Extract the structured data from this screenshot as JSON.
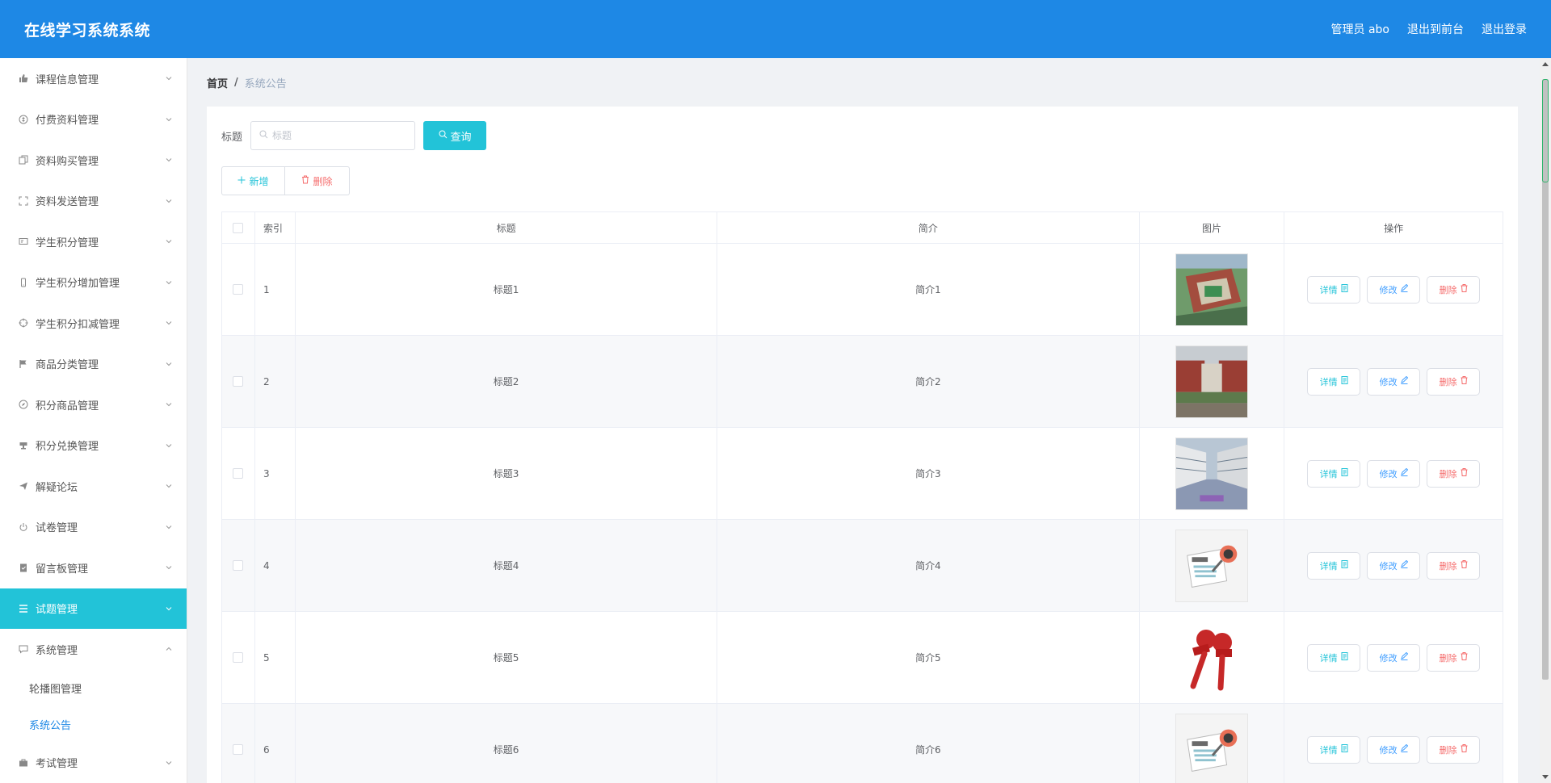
{
  "header": {
    "title": "在线学习系统系统",
    "user": "管理员 abo",
    "to_front": "退出到前台",
    "logout": "退出登录"
  },
  "sidebar": {
    "items": [
      {
        "label": "课程信息管理",
        "icon": "thumb-icon"
      },
      {
        "label": "付费资料管理",
        "icon": "coin-icon"
      },
      {
        "label": "资料购买管理",
        "icon": "copy-icon"
      },
      {
        "label": "资料发送管理",
        "icon": "fullscreen-icon"
      },
      {
        "label": "学生积分管理",
        "icon": "card-icon"
      },
      {
        "label": "学生积分增加管理",
        "icon": "mobile-icon"
      },
      {
        "label": "学生积分扣减管理",
        "icon": "aim-icon"
      },
      {
        "label": "商品分类管理",
        "icon": "flag-icon"
      },
      {
        "label": "积分商品管理",
        "icon": "compass-icon"
      },
      {
        "label": "积分兑换管理",
        "icon": "stamp-icon"
      },
      {
        "label": "解疑论坛",
        "icon": "send-icon"
      },
      {
        "label": "试卷管理",
        "icon": "power-icon"
      },
      {
        "label": "留言板管理",
        "icon": "clipboard-icon"
      },
      {
        "label": "试题管理",
        "icon": "grid-icon"
      },
      {
        "label": "系统管理",
        "icon": "chat-icon"
      },
      {
        "label": "考试管理",
        "icon": "briefcase-icon"
      }
    ],
    "system_sub": [
      "轮播图管理",
      "系统公告"
    ]
  },
  "breadcrumb": {
    "home": "首页",
    "sep": "/",
    "current": "系统公告"
  },
  "search": {
    "label": "标题",
    "placeholder": "标题",
    "button": "查询"
  },
  "actions": {
    "add": "新增",
    "delete": "删除"
  },
  "table": {
    "headers": {
      "index": "索引",
      "title": "标题",
      "intro": "简介",
      "image": "图片",
      "op": "操作"
    },
    "ops": {
      "detail": "详情",
      "edit": "修改",
      "remove": "删除"
    },
    "rows": [
      {
        "index": "1",
        "title": "标题1",
        "intro": "简介1",
        "image": "campus-aerial"
      },
      {
        "index": "2",
        "title": "标题2",
        "intro": "简介2",
        "image": "campus-building"
      },
      {
        "index": "3",
        "title": "标题3",
        "intro": "简介3",
        "image": "campus-courtyard"
      },
      {
        "index": "4",
        "title": "标题4",
        "intro": "简介4",
        "image": "news-illustration"
      },
      {
        "index": "5",
        "title": "标题5",
        "intro": "简介5",
        "image": "live-microphone"
      },
      {
        "index": "6",
        "title": "标题6",
        "intro": "简介6",
        "image": "news-illustration"
      }
    ]
  },
  "colors": {
    "header_bg": "#1e88e5",
    "accent": "#22c3d8",
    "danger": "#f56c6c",
    "primary": "#409eff"
  }
}
